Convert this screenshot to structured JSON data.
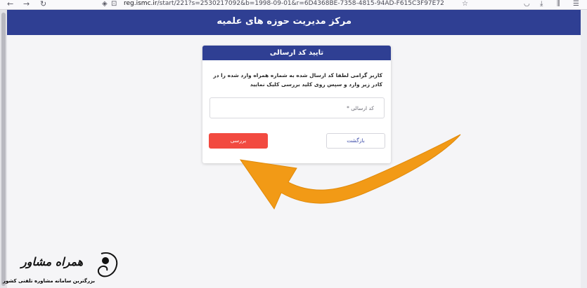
{
  "browser": {
    "back_icon": "arrow-left-icon",
    "forward_icon": "arrow-right-icon",
    "reload_icon": "reload-icon",
    "url_host": "reg.ismc.ir",
    "url_rest": "/start/221?s=2530217092&b=1998-09-01&r=6D4368BE-7358-4815-94AD-F615C3F97E72",
    "bookmark_icon": "star-icon"
  },
  "header": {
    "title": "مرکز مدیریت حوزه های علمیه"
  },
  "card": {
    "title": "تایید کد ارسالی",
    "instruction": "کاربر گرامی لطفا کد ارسال شده به شماره همراه وارد شده را در کادر زیر وارد و سپس روی کلید بررسی کلیک نمایید",
    "input_placeholder": "کد ارسالی *",
    "check_button": "بررسی",
    "back_button": "بازگشت"
  },
  "watermark": {
    "brand": "همراه مشاور",
    "tagline": "بزرگترین سامانه مشاوره تلفنی کشور"
  },
  "colors": {
    "primary": "#2f3f93",
    "danger": "#f24a40",
    "arrow": "#f29a16"
  }
}
